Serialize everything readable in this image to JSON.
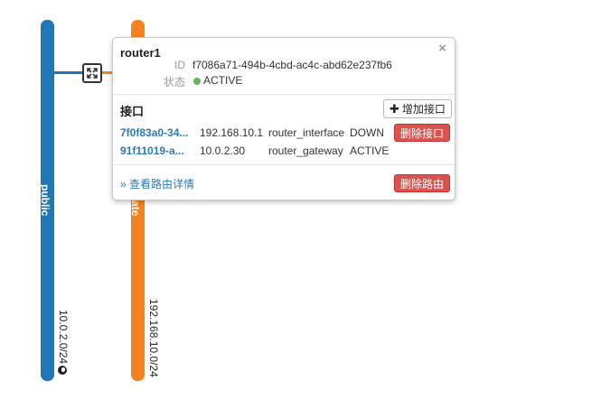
{
  "networks": [
    {
      "name": "public",
      "cidr": "10.0.2.0/24",
      "color": "#1f78b4",
      "external_icon": "globe-icon"
    },
    {
      "name": "ate",
      "cidr": "192.168.10.0/24",
      "color": "#f58220"
    }
  ],
  "router_popup": {
    "title": "router1",
    "close_label": "×",
    "id_label": "ID",
    "id_value": "f7086a71-494b-4cbd-ac4c-abd62e237fb6",
    "status_label": "状态",
    "status_value": "ACTIVE",
    "status_color": "#5cb85c",
    "interfaces_title": "接口",
    "add_interface_label": "增加接口",
    "interfaces": [
      {
        "port": "7f0f83a0-34...",
        "ip": "192.168.10.1",
        "owner": "router_interface",
        "status": "DOWN",
        "delete_label": "删除接口"
      },
      {
        "port": "91f11019-a...",
        "ip": "10.0.2.30",
        "owner": "router_gateway",
        "status": "ACTIVE"
      }
    ],
    "detail_link": "» 查看路由详情",
    "delete_router_label": "删除路由"
  }
}
